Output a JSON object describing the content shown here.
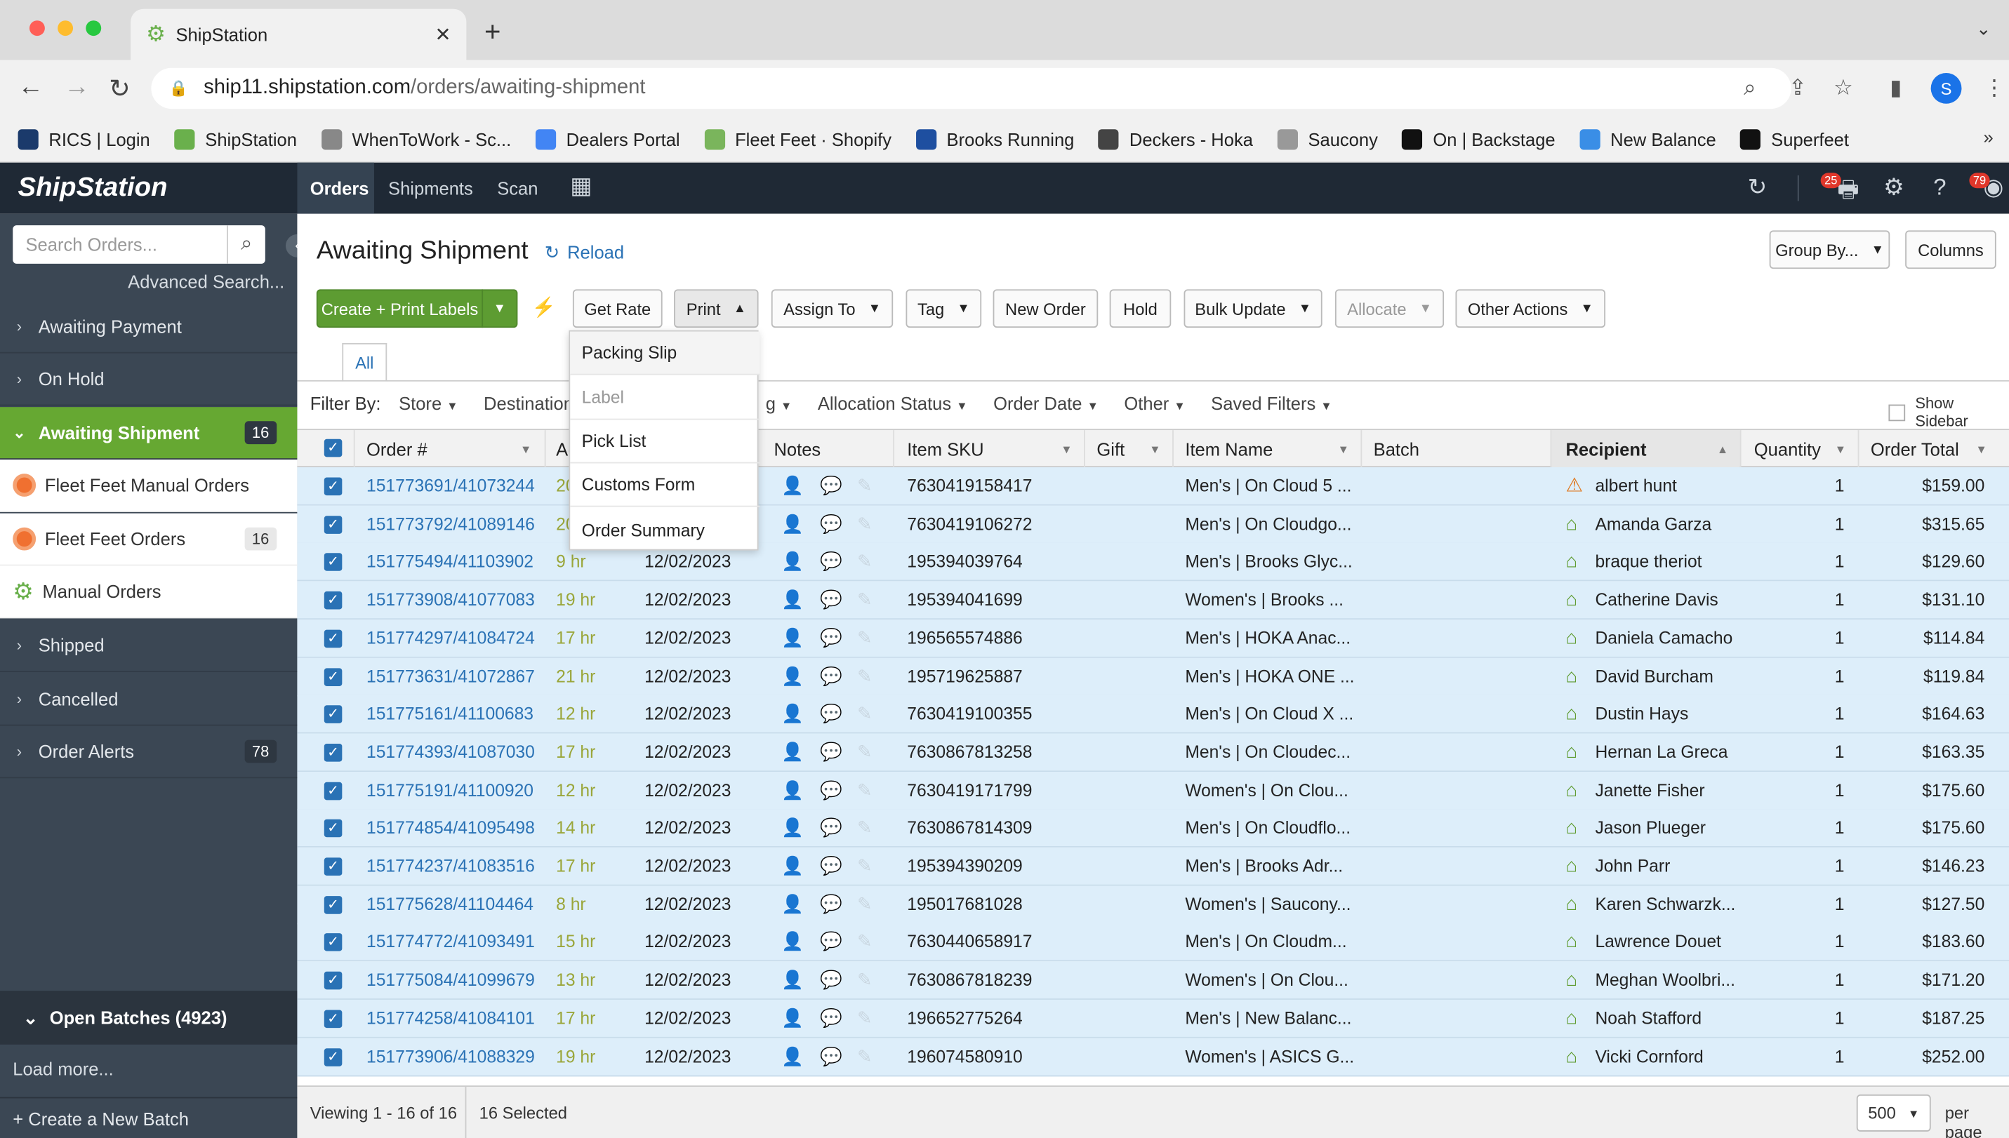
{
  "browser": {
    "tab_title": "ShipStation",
    "url_host": "ship11.shipstation.com",
    "url_path": "/orders/awaiting-shipment",
    "profile_initial": "S",
    "bookmarks": [
      {
        "label": "RICS | Login",
        "icon": "rics-icon",
        "color": "#1b3a6b"
      },
      {
        "label": "ShipStation",
        "icon": "gear-icon",
        "color": "#6ab04c"
      },
      {
        "label": "WhenToWork - Sc...",
        "icon": "w-icon",
        "color": "#888888"
      },
      {
        "label": "Dealers Portal",
        "icon": "google-icon",
        "color": "#4285f4"
      },
      {
        "label": "Fleet Feet · Shopify",
        "icon": "shopify-icon",
        "color": "#7ab55c"
      },
      {
        "label": "Brooks Running",
        "icon": "brooks-icon",
        "color": "#1e4fa0"
      },
      {
        "label": "Deckers - Hoka",
        "icon": "deckers-icon",
        "color": "#444444"
      },
      {
        "label": "Saucony",
        "icon": "saucony-icon",
        "color": "#999999"
      },
      {
        "label": "On | Backstage",
        "icon": "on-icon",
        "color": "#111111"
      },
      {
        "label": "New Balance",
        "icon": "cloud-icon",
        "color": "#3a8ee6"
      },
      {
        "label": "Superfeet",
        "icon": "superfeet-icon",
        "color": "#111111"
      }
    ]
  },
  "app": {
    "logo": "ShipStation",
    "nav": [
      "Orders",
      "Shipments",
      "Scan"
    ],
    "print_badge": "25",
    "alerts_badge": "79"
  },
  "sidebar": {
    "search_placeholder": "Search Orders...",
    "advanced_search": "Advanced Search...",
    "items": [
      {
        "label": "Awaiting Payment"
      },
      {
        "label": "On Hold"
      },
      {
        "label": "Awaiting Shipment",
        "count": "16"
      },
      {
        "label": "Shipped"
      },
      {
        "label": "Cancelled"
      },
      {
        "label": "Order Alerts",
        "count": "78"
      }
    ],
    "sub_items": [
      {
        "label": "Fleet Feet Manual Orders"
      },
      {
        "label": "Fleet Feet Orders",
        "count": "16"
      },
      {
        "label": "Manual Orders"
      }
    ],
    "open_batches": "Open Batches (4923)",
    "load_more": "Load more...",
    "create_batch": "+ Create a New Batch"
  },
  "main": {
    "title": "Awaiting Shipment",
    "reload": "Reload",
    "buttons": {
      "create_print": "Create + Print Labels",
      "get_rate": "Get Rate",
      "print": "Print",
      "assign_to": "Assign To",
      "tag": "Tag",
      "new_order": "New Order",
      "hold": "Hold",
      "bulk_update": "Bulk Update",
      "allocate": "Allocate",
      "other_actions": "Other Actions",
      "group_by": "Group By...",
      "columns": "Columns"
    },
    "tab_all": "All",
    "filter_by": "Filter By:",
    "filters": [
      "Store",
      "Destination",
      "g",
      "Allocation Status",
      "Order Date",
      "Other",
      "Saved Filters"
    ],
    "show_sidebar": "Show Sidebar",
    "print_menu": [
      "Packing Slip",
      "Label",
      "Pick List",
      "Customs Form",
      "Order Summary"
    ],
    "columns": {
      "order": "Order #",
      "age": "Ag",
      "notes": "Notes",
      "sku": "Item SKU",
      "gift": "Gift",
      "item_name": "Item Name",
      "batch": "Batch",
      "recipient": "Recipient",
      "quantity": "Quantity",
      "total": "Order Total"
    },
    "rows": [
      {
        "order": "151773691/41073244",
        "age": "20",
        "date": "",
        "sku": "7630419158417",
        "item": "Men's | On Cloud 5 ...",
        "recipient": "albert hunt",
        "qty": "1",
        "total": "$159.00",
        "status_icon": "warning-icon"
      },
      {
        "order": "151773792/41089146",
        "age": "20",
        "date": "",
        "sku": "7630419106272",
        "item": "Men's | On Cloudgo...",
        "recipient": "Amanda Garza",
        "qty": "1",
        "total": "$315.65",
        "status_icon": "home-icon"
      },
      {
        "order": "151775494/41103902",
        "age": "9 hr",
        "date": "12/02/2023",
        "sku": "195394039764",
        "item": "Men's | Brooks Glyc...",
        "recipient": "braque theriot",
        "qty": "1",
        "total": "$129.60",
        "status_icon": "home-icon"
      },
      {
        "order": "151773908/41077083",
        "age": "19 hr",
        "date": "12/02/2023",
        "sku": "195394041699",
        "item": "Women's | Brooks ...",
        "recipient": "Catherine Davis",
        "qty": "1",
        "total": "$131.10",
        "status_icon": "home-icon"
      },
      {
        "order": "151774297/41084724",
        "age": "17 hr",
        "date": "12/02/2023",
        "sku": "196565574886",
        "item": "Men's | HOKA Anac...",
        "recipient": "Daniela Camacho",
        "qty": "1",
        "total": "$114.84",
        "status_icon": "home-icon"
      },
      {
        "order": "151773631/41072867",
        "age": "21 hr",
        "date": "12/02/2023",
        "sku": "195719625887",
        "item": "Men's | HOKA ONE ...",
        "recipient": "David Burcham",
        "qty": "1",
        "total": "$119.84",
        "status_icon": "home-icon"
      },
      {
        "order": "151775161/41100683",
        "age": "12 hr",
        "date": "12/02/2023",
        "sku": "7630419100355",
        "item": "Men's | On Cloud X ...",
        "recipient": "Dustin Hays",
        "qty": "1",
        "total": "$164.63",
        "status_icon": "home-icon"
      },
      {
        "order": "151774393/41087030",
        "age": "17 hr",
        "date": "12/02/2023",
        "sku": "7630867813258",
        "item": "Men's | On Cloudec...",
        "recipient": "Hernan La Greca",
        "qty": "1",
        "total": "$163.35",
        "status_icon": "home-icon"
      },
      {
        "order": "151775191/41100920",
        "age": "12 hr",
        "date": "12/02/2023",
        "sku": "7630419171799",
        "item": "Women's | On Clou...",
        "recipient": "Janette Fisher",
        "qty": "1",
        "total": "$175.60",
        "status_icon": "home-icon"
      },
      {
        "order": "151774854/41095498",
        "age": "14 hr",
        "date": "12/02/2023",
        "sku": "7630867814309",
        "item": "Men's | On Cloudflo...",
        "recipient": "Jason Plueger",
        "qty": "1",
        "total": "$175.60",
        "status_icon": "home-icon"
      },
      {
        "order": "151774237/41083516",
        "age": "17 hr",
        "date": "12/02/2023",
        "sku": "195394390209",
        "item": "Men's | Brooks Adr...",
        "recipient": "John Parr",
        "qty": "1",
        "total": "$146.23",
        "status_icon": "home-icon"
      },
      {
        "order": "151775628/41104464",
        "age": "8 hr",
        "date": "12/02/2023",
        "sku": "195017681028",
        "item": "Women's | Saucony...",
        "recipient": "Karen Schwarzk...",
        "qty": "1",
        "total": "$127.50",
        "status_icon": "home-icon"
      },
      {
        "order": "151774772/41093491",
        "age": "15 hr",
        "date": "12/02/2023",
        "sku": "7630440658917",
        "item": "Men's | On Cloudm...",
        "recipient": "Lawrence Douet",
        "qty": "1",
        "total": "$183.60",
        "status_icon": "home-icon"
      },
      {
        "order": "151775084/41099679",
        "age": "13 hr",
        "date": "12/02/2023",
        "sku": "7630867818239",
        "item": "Women's | On Clou...",
        "recipient": "Meghan Woolbri...",
        "qty": "1",
        "total": "$171.20",
        "status_icon": "home-icon"
      },
      {
        "order": "151774258/41084101",
        "age": "17 hr",
        "date": "12/02/2023",
        "sku": "196652775264",
        "item": "Men's | New Balanc...",
        "recipient": "Noah Stafford",
        "qty": "1",
        "total": "$187.25",
        "status_icon": "home-icon"
      },
      {
        "order": "151773906/41088329",
        "age": "19 hr",
        "date": "12/02/2023",
        "sku": "196074580910",
        "item": "Women's | ASICS G...",
        "recipient": "Vicki Cornford",
        "qty": "1",
        "total": "$252.00",
        "status_icon": "home-icon"
      }
    ],
    "footer": {
      "viewing": "Viewing 1 - 16 of 16",
      "selected": "16 Selected",
      "page_size": "500",
      "per_page": "per page"
    }
  }
}
